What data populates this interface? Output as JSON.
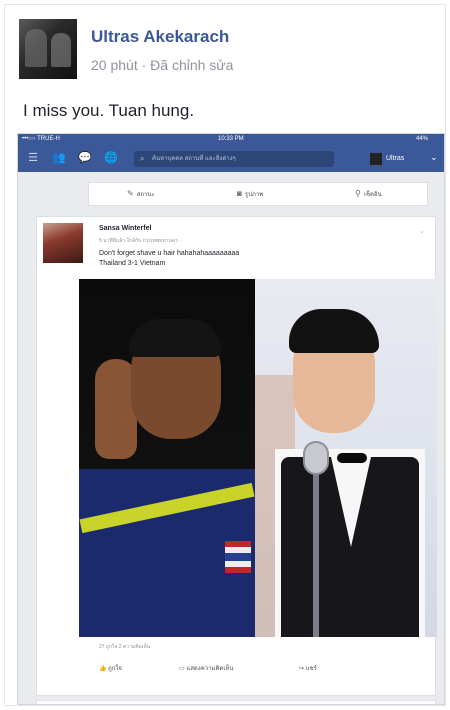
{
  "post": {
    "author": "Ultras Akekarach",
    "meta": "20 phút · Đã chỉnh sửa",
    "message": "I miss you. Tuan hung."
  },
  "screenshot": {
    "statusbar": {
      "carrier": "•••○○ TRUE-H",
      "time": "10:33 PM",
      "battery": "44%"
    },
    "navbar": {
      "search_placeholder": "ค้นหาบุคคล สถานที่ และสิ่งต่างๆ",
      "user_name": "Ultras"
    },
    "composer": {
      "status_label": "สถานะ",
      "photo_label": "รูปภาพ",
      "checkin_label": "เช็คอิน"
    },
    "inner_post": {
      "name": "Sansa Winterfel",
      "meta": "5 นาทีที่แล้ว ใกล้กับ กรุงเทพมหานคร · ",
      "line1": "Don't forget shave u hair hahahahaaaaaaaaa",
      "line2": "Thailand 3-1 Vietnam",
      "stats": "27 ถูกใจ  2 ความคิดเห็น",
      "like_label": "ถูกใจ",
      "comment_label": "แสดงความคิดเห็น",
      "share_label": "แชร์"
    }
  },
  "colors": {
    "facebook_blue": "#3b5998",
    "link_blue": "#3b5998"
  }
}
